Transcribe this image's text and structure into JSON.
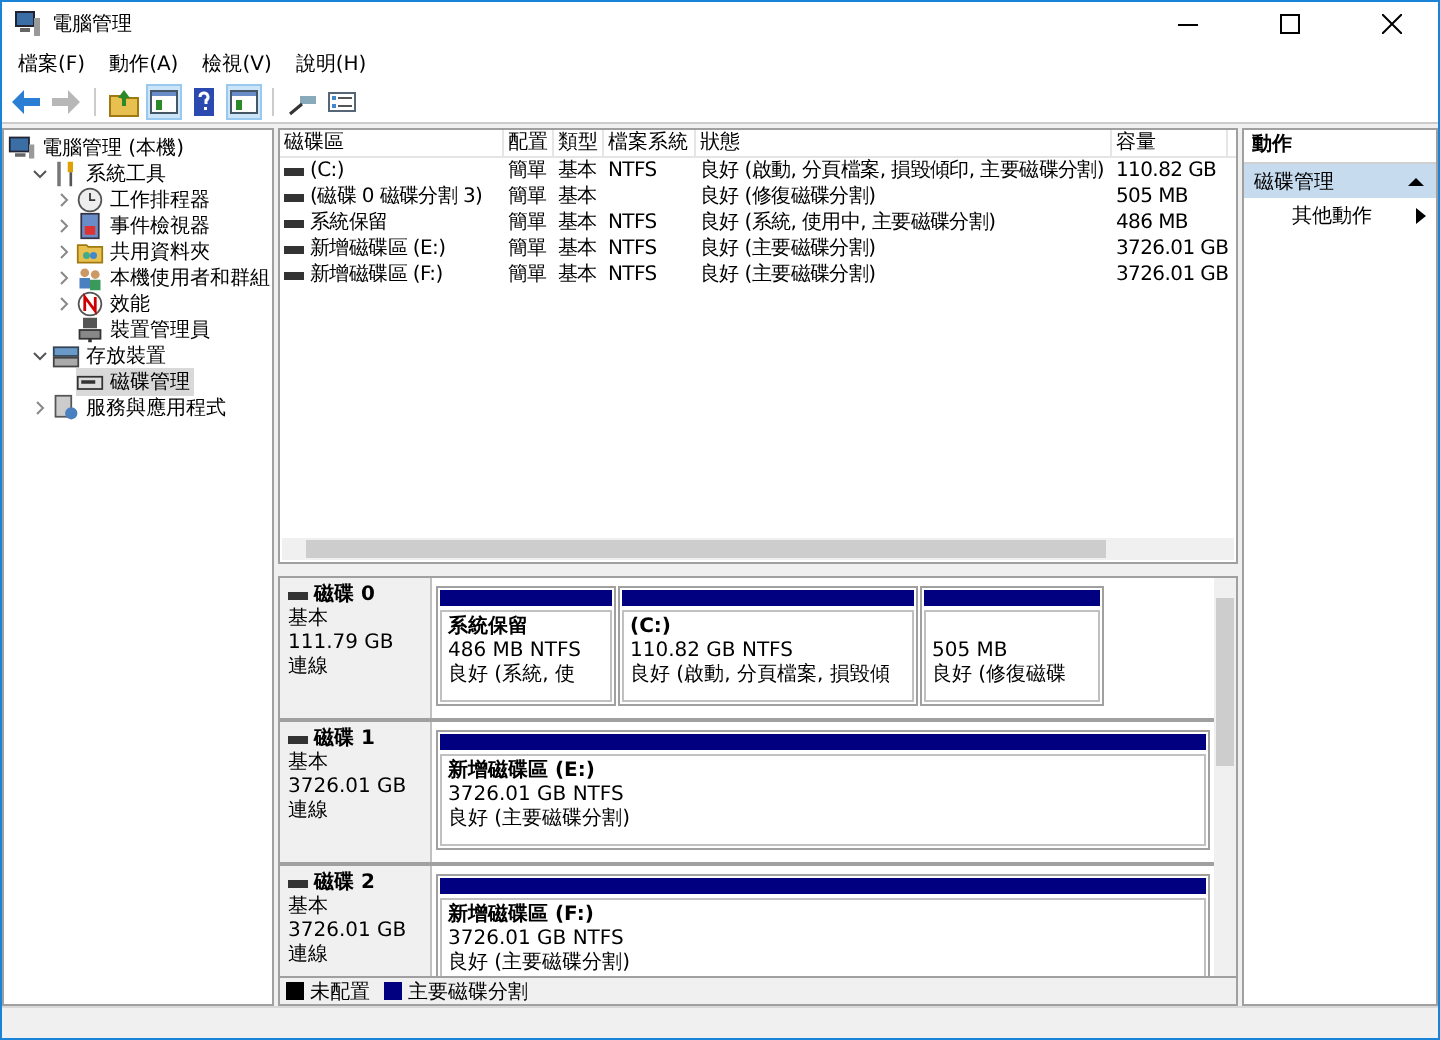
{
  "window": {
    "title": "電腦管理"
  },
  "menu": [
    "檔案(F)",
    "動作(A)",
    "檢視(V)",
    "說明(H)"
  ],
  "toolbar": [
    {
      "kind": "back",
      "disabled": false
    },
    {
      "kind": "forward",
      "disabled": true
    },
    {
      "kind": "up",
      "disabled": false
    },
    {
      "kind": "pane",
      "pressed": true
    },
    {
      "kind": "help",
      "disabled": false
    },
    {
      "kind": "pane",
      "pressed": true
    },
    {
      "kind": "connect",
      "disabled": false
    },
    {
      "kind": "list",
      "disabled": false
    }
  ],
  "tree": [
    {
      "label": "電腦管理 (本機)",
      "selected": false,
      "children": [
        {
          "label": "系統工具",
          "expanded": true,
          "selected": false,
          "children": [
            {
              "label": "工作排程器",
              "expanded": false,
              "selected": false
            },
            {
              "label": "事件檢視器",
              "expanded": false,
              "selected": false
            },
            {
              "label": "共用資料夾",
              "expanded": false,
              "selected": false
            },
            {
              "label": "本機使用者和群組",
              "expanded": false,
              "selected": false
            },
            {
              "label": "效能",
              "expanded": false,
              "selected": false
            },
            {
              "label": "裝置管理員",
              "selected": false
            }
          ]
        },
        {
          "label": "存放裝置",
          "expanded": true,
          "selected": false,
          "children": [
            {
              "label": "磁碟管理",
              "selected": true
            }
          ]
        },
        {
          "label": "服務與應用程式",
          "expanded": false,
          "selected": false
        }
      ]
    }
  ],
  "volume_list": {
    "columns": [
      "磁碟區",
      "配置",
      "類型",
      "檔案系統",
      "狀態",
      "容量"
    ],
    "rows": [
      {
        "volume": "(C:)",
        "layout": "簡單",
        "type": "基本",
        "file_system": "NTFS",
        "status": "良好 (啟動, 分頁檔案, 損毀傾印, 主要磁碟分割)",
        "capacity": "110.82 GB"
      },
      {
        "volume": "(磁碟 0 磁碟分割 3)",
        "layout": "簡單",
        "type": "基本",
        "status": "良好 (修復磁碟分割)",
        "capacity": "505 MB"
      },
      {
        "volume": "系統保留",
        "layout": "簡單",
        "type": "基本",
        "file_system": "NTFS",
        "status": "良好 (系統, 使用中, 主要磁碟分割)",
        "capacity": "486 MB"
      },
      {
        "volume": "新增磁碟區 (E:)",
        "layout": "簡單",
        "type": "基本",
        "file_system": "NTFS",
        "status": "良好 (主要磁碟分割)",
        "capacity": "3726.01 GB"
      },
      {
        "volume": "新增磁碟區 (F:)",
        "layout": "簡單",
        "type": "基本",
        "file_system": "NTFS",
        "status": "良好 (主要磁碟分割)",
        "capacity": "3726.01 GB"
      }
    ]
  },
  "disks": [
    {
      "name": "磁碟 0",
      "type": "基本",
      "size": "111.79 GB",
      "status": "連線",
      "partitions": [
        {
          "label": "系統保留",
          "size": "486 MB NTFS",
          "status": "良好 (系統, 使"
        },
        {
          "label": "(C:)",
          "size": "110.82 GB NTFS",
          "status": "良好 (啟動, 分頁檔案, 損毀傾"
        },
        {
          "size": "505 MB",
          "status": "良好 (修復磁碟"
        }
      ]
    },
    {
      "name": "磁碟 1",
      "type": "基本",
      "size": "3726.01 GB",
      "status": "連線",
      "partitions": [
        {
          "label": "新增磁碟區  (E:)",
          "size": "3726.01 GB NTFS",
          "status": "良好 (主要磁碟分割)"
        }
      ]
    },
    {
      "name": "磁碟 2",
      "type": "基本",
      "size": "3726.01 GB",
      "status": "連線",
      "partitions": [
        {
          "label": "新增磁碟區  (F:)",
          "size": "3726.01 GB NTFS",
          "status": "良好 (主要磁碟分割)"
        }
      ]
    }
  ],
  "legend": [
    {
      "label": "未配置",
      "color": "#000000"
    },
    {
      "label": "主要磁碟分割",
      "color": "#000080"
    }
  ],
  "actions": {
    "header": "動作",
    "section": {
      "title": "磁碟管理",
      "expanded": true
    },
    "items": [
      "其他動作"
    ]
  }
}
